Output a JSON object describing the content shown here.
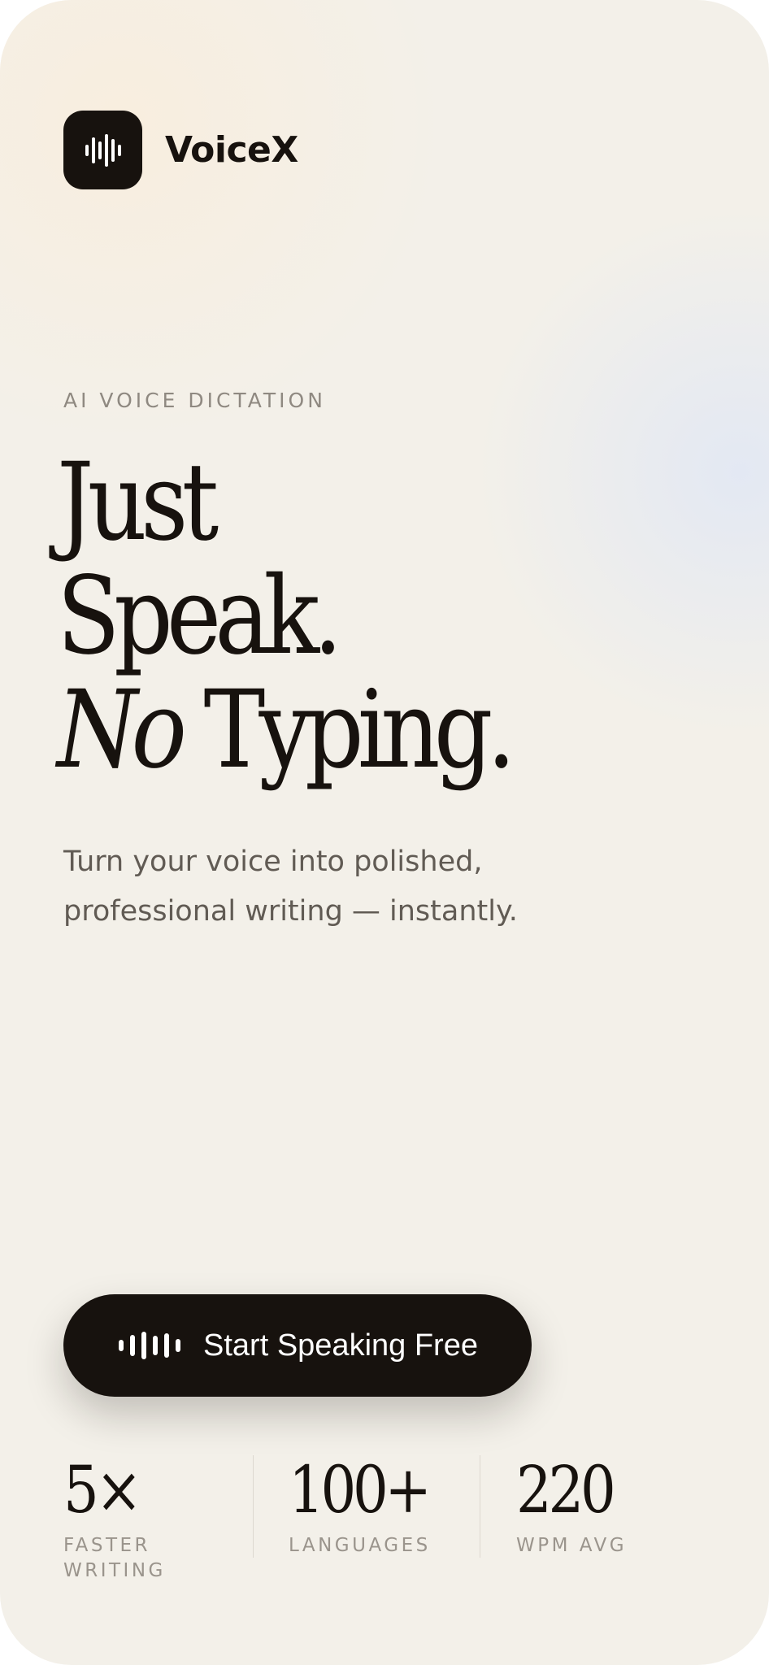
{
  "brand": {
    "name": "VoiceX",
    "icon": "waveform-icon"
  },
  "hero": {
    "eyebrow": "AI VOICE DICTATION",
    "headline_line1": "Just",
    "headline_line2": "Speak.",
    "headline_line3_italic": "No",
    "headline_line3_rest": " Typing.",
    "subtitle": "Turn your voice into polished, professional writing — instantly."
  },
  "cta": {
    "label": "Start Speaking Free",
    "icon": "waveform-icon"
  },
  "stats": [
    {
      "value": "5×",
      "label": "FASTER WRITING"
    },
    {
      "value": "100+",
      "label": "LANGUAGES"
    },
    {
      "value": "220",
      "label": "WPM AVG"
    }
  ],
  "colors": {
    "ink": "#17120e",
    "background": "#f3f0e9",
    "muted_text": "#8f8981",
    "body_text": "#615b54"
  }
}
